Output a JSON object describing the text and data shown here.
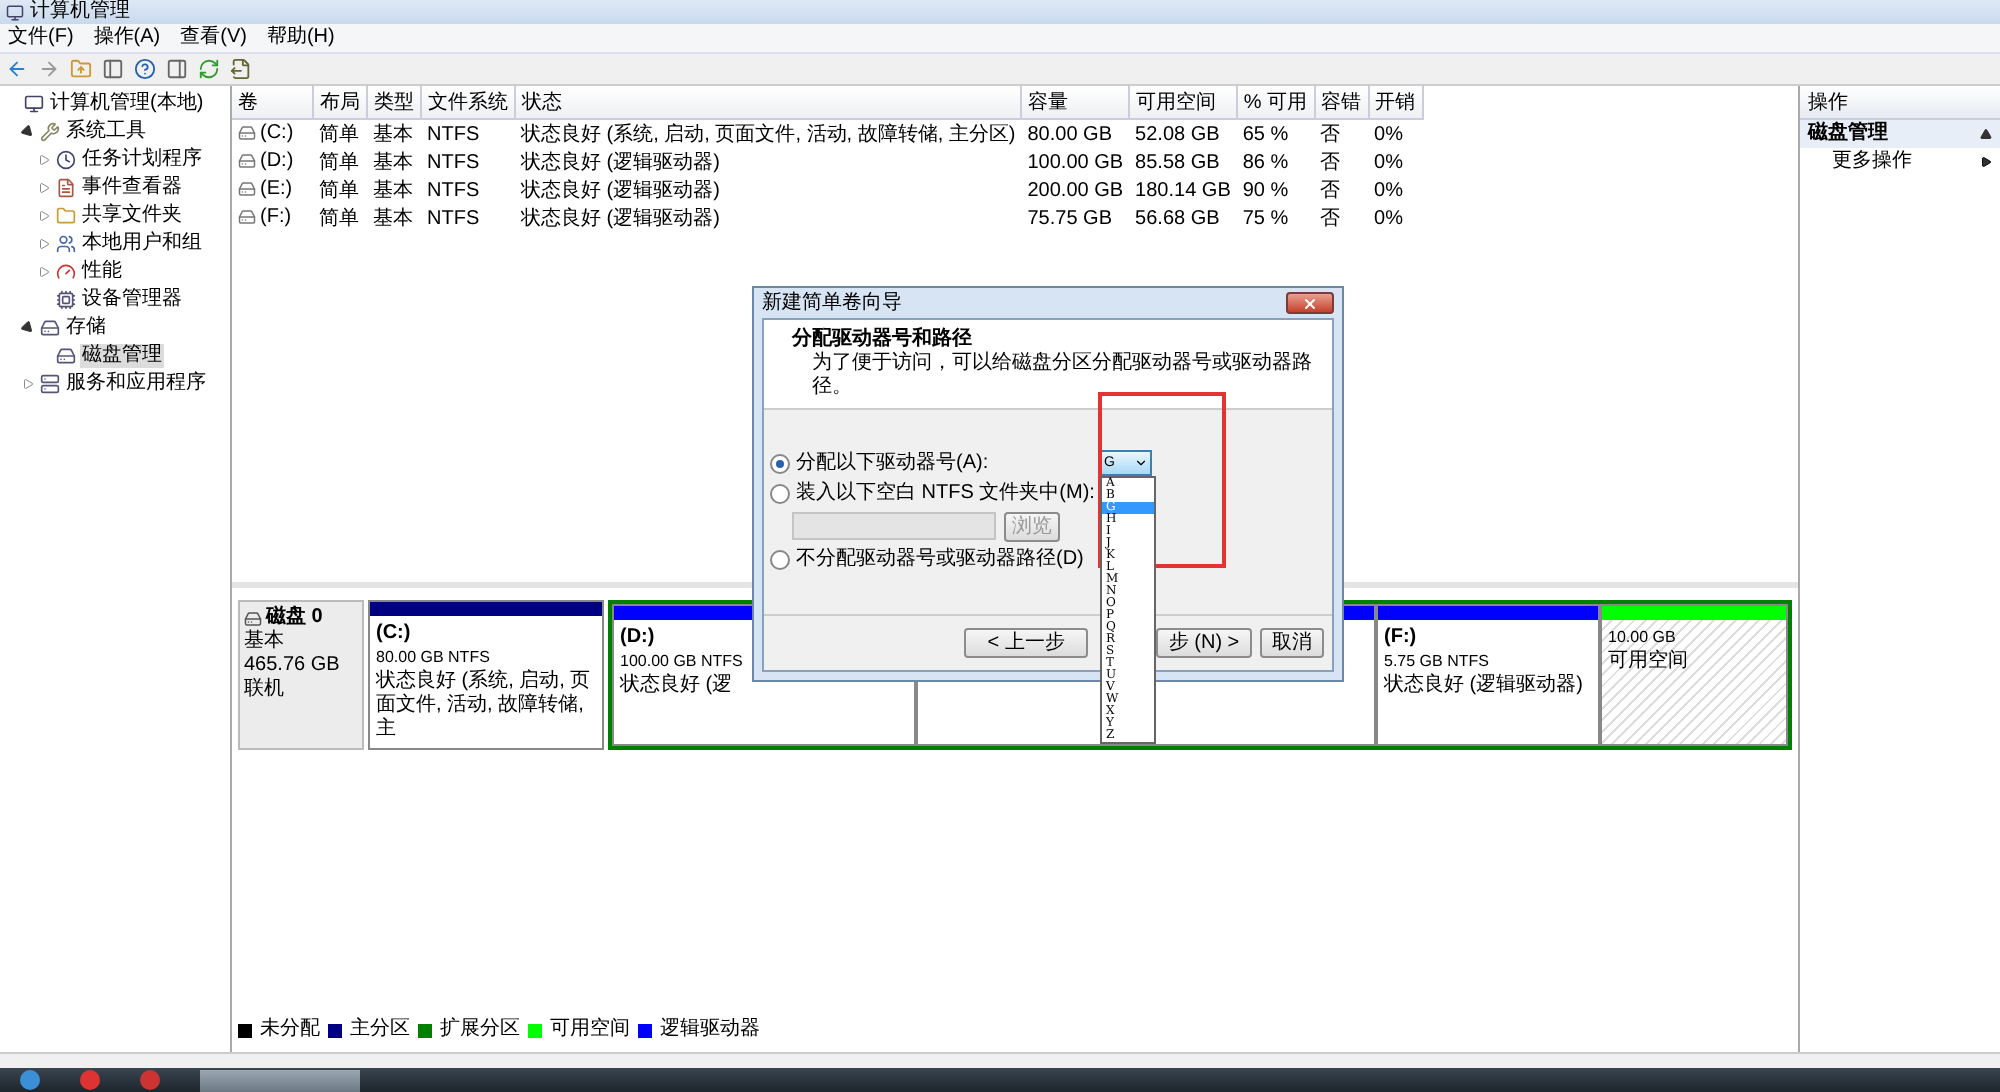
{
  "window": {
    "title": "计算机管理"
  },
  "menu": [
    "文件(F)",
    "操作(A)",
    "查看(V)",
    "帮助(H)"
  ],
  "tree": [
    {
      "label": "计算机管理(本地)",
      "selected": false,
      "children": [
        {
          "label": "系统工具",
          "expanded": true,
          "selected": false,
          "children": [
            {
              "label": "任务计划程序",
              "expanded": false,
              "selected": false
            },
            {
              "label": "事件查看器",
              "expanded": false,
              "selected": false
            },
            {
              "label": "共享文件夹",
              "expanded": false,
              "selected": false
            },
            {
              "label": "本地用户和组",
              "expanded": false,
              "selected": false
            },
            {
              "label": "性能",
              "expanded": false,
              "selected": false
            },
            {
              "label": "设备管理器",
              "selected": false
            }
          ]
        },
        {
          "label": "存储",
          "expanded": true,
          "selected": false,
          "children": [
            {
              "label": "磁盘管理",
              "selected": true
            }
          ]
        },
        {
          "label": "服务和应用程序",
          "expanded": false,
          "selected": false
        }
      ]
    }
  ],
  "volumes": {
    "columns": [
      "卷",
      "布局",
      "类型",
      "文件系统",
      "状态",
      "容量",
      "可用空间",
      "% 可用",
      "容错",
      "开销"
    ],
    "rows": [
      [
        "(C:)",
        "简单",
        "基本",
        "NTFS",
        "状态良好 (系统, 启动, 页面文件, 活动, 故障转储, 主分区)",
        "80.00 GB",
        "52.08 GB",
        "65 %",
        "否",
        "0%"
      ],
      [
        "(D:)",
        "简单",
        "基本",
        "NTFS",
        "状态良好 (逻辑驱动器)",
        "100.00 GB",
        "85.58 GB",
        "86 %",
        "否",
        "0%"
      ],
      [
        "(E:)",
        "简单",
        "基本",
        "NTFS",
        "状态良好 (逻辑驱动器)",
        "200.00 GB",
        "180.14 GB",
        "90 %",
        "否",
        "0%"
      ],
      [
        "(F:)",
        "简单",
        "基本",
        "NTFS",
        "状态良好 (逻辑驱动器)",
        "75.75 GB",
        "56.68 GB",
        "75 %",
        "否",
        "0%"
      ]
    ]
  },
  "disk": {
    "name": "磁盘 0",
    "type": "基本",
    "size": "465.76 GB",
    "status": "联机",
    "partitions": [
      {
        "kind": "primary",
        "color": "#000080",
        "title": "(C:)",
        "lines": [
          "80.00 GB NTFS",
          "状态良好 (系统, 启动, 页面文件, 活动, 故障转储, 主"
        ]
      },
      {
        "kind": "extended",
        "color": "#008000",
        "children": [
          {
            "kind": "logical",
            "color": "#0000ff",
            "title": "(D:)",
            "lines": [
              "100.00 GB NTFS",
              "状态良好 (逻"
            ]
          },
          {
            "kind": "logical",
            "color": "#0000ff"
          },
          {
            "kind": "logical",
            "color": "#0000ff",
            "title": "(F:)",
            "lines": [
              "5.75 GB NTFS",
              "状态良好 (逻辑驱动器)"
            ]
          },
          {
            "kind": "free",
            "color": "#00ff00",
            "lines": [
              "10.00 GB",
              "可用空间"
            ]
          }
        ]
      }
    ]
  },
  "legend": [
    {
      "label": "未分配",
      "color": "#000000"
    },
    {
      "label": "主分区",
      "color": "#000080"
    },
    {
      "label": "扩展分区",
      "color": "#008000"
    },
    {
      "label": "可用空间",
      "color": "#00ff00"
    },
    {
      "label": "逻辑驱动器",
      "color": "#0000ff"
    }
  ],
  "actions": {
    "header": "操作",
    "section": "磁盘管理",
    "items": [
      "更多操作"
    ]
  },
  "dialog": {
    "title": "新建简单卷向导",
    "heading": "分配驱动器号和路径",
    "subtitle": "为了便于访问，可以给磁盘分区分配驱动器号或驱动器路径。",
    "options": [
      {
        "kind": "letter",
        "label": "分配以下驱动器号(A):",
        "selected": true
      },
      {
        "kind": "folder",
        "label": "装入以下空白 NTFS 文件夹中(M):",
        "selected": false
      },
      {
        "kind": "none",
        "label": "不分配驱动器号或驱动器路径(D)",
        "selected": false
      }
    ],
    "combo": {
      "value": "G",
      "expanded": true
    },
    "folder_field": {
      "disabled": true
    },
    "browse": {
      "label": "浏览",
      "disabled": true
    },
    "letters": [
      {
        "label": "A",
        "selected": false
      },
      {
        "label": "B",
        "selected": false
      },
      {
        "label": "G",
        "selected": true
      },
      {
        "label": "H",
        "selected": false
      },
      {
        "label": "I",
        "selected": false
      },
      {
        "label": "J",
        "selected": false
      },
      {
        "label": "K",
        "selected": false
      },
      {
        "label": "L",
        "selected": false
      },
      {
        "label": "M",
        "selected": false
      },
      {
        "label": "N",
        "selected": false
      },
      {
        "label": "O",
        "selected": false
      },
      {
        "label": "P",
        "selected": false
      },
      {
        "label": "Q",
        "selected": false
      },
      {
        "label": "R",
        "selected": false
      },
      {
        "label": "S",
        "selected": false
      },
      {
        "label": "T",
        "selected": false
      },
      {
        "label": "U",
        "selected": false
      },
      {
        "label": "V",
        "selected": false
      },
      {
        "label": "W",
        "selected": false
      },
      {
        "label": "X",
        "selected": false
      },
      {
        "label": "Y",
        "selected": false
      },
      {
        "label": "Z",
        "selected": false
      }
    ],
    "back": "< 上一步",
    "next": "步 (N) >",
    "cancel": "取消"
  }
}
